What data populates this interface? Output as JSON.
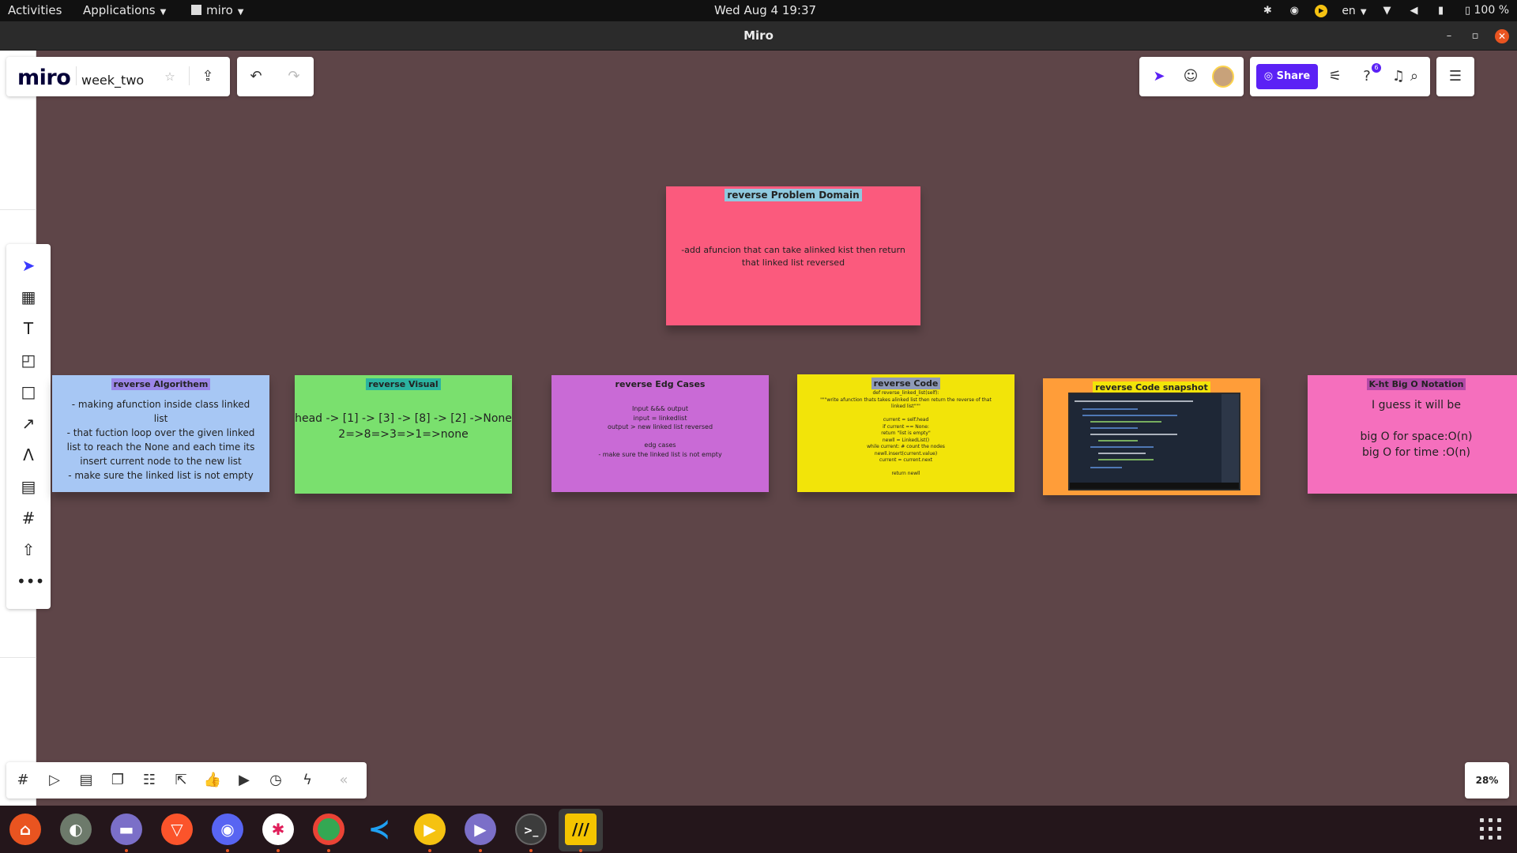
{
  "topbar": {
    "activities": "Activities",
    "applications": "Applications",
    "app_name": "miro",
    "clock": "Wed Aug 4  19:37",
    "language": "en",
    "battery": "100 %"
  },
  "window": {
    "title": "Miro"
  },
  "board": {
    "logo": "miro",
    "name": "week_two",
    "share_label": "Share",
    "help_badge": "6",
    "zoom": "28%"
  },
  "notes": [
    {
      "header": "reverse Problem Domain",
      "body": "-add afuncion that can take alinked kist then return\nthat linked list reversed",
      "color": "#fb5a7d"
    },
    {
      "header": "reverse Algorithem",
      "body": "- making afunction inside class linked\nlist\n- that fuction loop over the given linked\nlist to reach the None and each time its\ninsert current node to the new list\n- make sure the linked list is not empty",
      "color": "#a7c7f4"
    },
    {
      "header": "reverse Visual",
      "body": "head -> [1] -> [3] -> [8] -> [2] ->None\n2=>8=>3=>1=>none",
      "color": "#7ae06e"
    },
    {
      "header": "reverse Edg Cases",
      "body": "Input &&& output\ninput = linkedlist\noutput > new linked list reversed\n\nedg cases\n- make sure the linked list is not empty",
      "color": "#c96ad6"
    },
    {
      "header": "reverse Code",
      "body": "def reverse_linked_list(self):\n\"\"\"write afunction thats takes alinked list then return the reverse of that\nlinked list\"\"\"\n\ncurrent = self.head\nif current == None:\nreturn \"list is empty\"\nnewll = LinkedList()\nwhile current: # count the nodes\nnewll.insert(current.value)\ncurrent = current.next\n\nreturn newll",
      "color": "#f2e409"
    },
    {
      "header": "reverse Code snapshot",
      "body": "",
      "color": "#ff9d39"
    },
    {
      "header": "K-ht Big O Notation",
      "body": "I guess it will be\n\nbig O for space:O(n)\nbig O for time :O(n)",
      "color": "#f56fbd"
    }
  ],
  "colors": {
    "canvas": "#5e4548",
    "share_button": "#5b21f5",
    "topbar": "#111111",
    "dock": "#24161b"
  },
  "icons": {
    "toolbar": [
      "select-cursor-icon",
      "templates-icon",
      "text-icon",
      "sticky-note-icon",
      "shape-icon",
      "connection-line-icon",
      "pen-icon",
      "comment-icon",
      "frame-icon",
      "upload-icon",
      "more-icon"
    ],
    "bottom": [
      "frames-icon",
      "presentation-icon",
      "comments-icon",
      "card-icon",
      "kanban-icon",
      "share-screen-icon",
      "voting-icon",
      "video-icon",
      "timer-icon",
      "apps-icon",
      "collapse-icon"
    ],
    "dock": [
      "ubuntu-software-icon",
      "toggle-app-icon",
      "files-icon",
      "brave-icon",
      "discord-icon",
      "slack-icon",
      "chrome-icon",
      "vscode-icon",
      "media-player-icon",
      "video-player-icon",
      "terminal-icon",
      "miro-icon"
    ]
  }
}
